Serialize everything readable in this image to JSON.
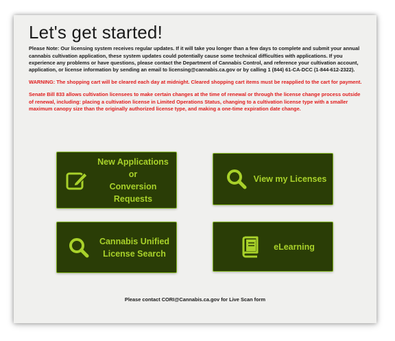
{
  "page": {
    "title": "Let's get started!",
    "note": "Please Note: Our licensing system receives regular updates. If it will take you longer than a few days to complete and submit your annual cannabis cultivation application, these system updates could potentially cause some technical difficulties with applications. If you experience any problems or have questions, please contact the Department of Cannabis Control, and reference your cultivation account, application, or license information by sending an email to licensing@cannabis.ca.gov or by calling 1 (844) 61-CA-DCC (1-844-612-2322).",
    "warning": "WARNING: The shopping cart will be cleared each day at midnight. Cleared shopping cart items must be reapplied to the cart for payment.",
    "senate_bill": "Senate Bill 833 allows cultivation licensees to make certain changes at the time of renewal or through the license change process outside of renewal, including: placing a cultivation license in Limited Operations Status, changing to a cultivation license type with a smaller maximum canopy size than the originally authorized license type, and making a one-time expiration date change."
  },
  "tiles": {
    "new_applications": {
      "label_1": "New Applications",
      "label_2": "or",
      "label_3": "Conversion",
      "label_4": "Requests",
      "icon": "edit-icon"
    },
    "view_licenses": {
      "label": "View my Licenses",
      "icon": "search-icon"
    },
    "license_search": {
      "label_1": "Cannabis Unified",
      "label_2": "License Search",
      "icon": "search-icon"
    },
    "elearning": {
      "label": "eLearning",
      "icon": "book-icon"
    }
  },
  "footer": {
    "prefix": "Please contact ",
    "email": "CORI@Cannabis.ca.gov",
    "suffix": " for Live Scan form"
  },
  "colors": {
    "tile_bg": "#2a3d06",
    "tile_border": "#7fb21c",
    "tile_text": "#a8d12a",
    "warning": "#e01b1b",
    "panel_bg": "#f0f0ee"
  }
}
